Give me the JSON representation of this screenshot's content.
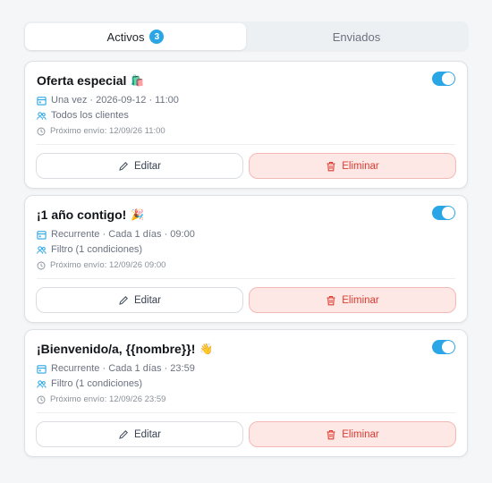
{
  "tabs": [
    {
      "label": "Activos",
      "badge": "3",
      "active": true
    },
    {
      "label": "Enviados",
      "active": false
    }
  ],
  "colors": {
    "accent": "#2aa6e6",
    "danger": "#dc3b30",
    "danger_bg": "#fde8e6"
  },
  "messages": [
    {
      "title": "Oferta especial",
      "emoji": "🛍️",
      "enabled": true,
      "schedule": "Una vez · 2026-09-12 · 11:00",
      "audience": "Todos los clientes",
      "next_send": "Próximo envío: 12/09/26 11:00",
      "edit_label": "Editar",
      "delete_label": "Eliminar"
    },
    {
      "title": "¡1 año contigo!",
      "emoji": "🎉",
      "enabled": true,
      "schedule": "Recurrente · Cada 1 días · 09:00",
      "audience": "Filtro (1 condiciones)",
      "next_send": "Próximo envío: 12/09/26 09:00",
      "edit_label": "Editar",
      "delete_label": "Eliminar"
    },
    {
      "title": "¡Bienvenido/a, {{nombre}}!",
      "emoji": "👋",
      "enabled": true,
      "schedule": "Recurrente · Cada 1 días · 23:59",
      "audience": "Filtro (1 condiciones)",
      "next_send": "Próximo envío: 12/09/26 23:59",
      "edit_label": "Editar",
      "delete_label": "Eliminar"
    }
  ]
}
